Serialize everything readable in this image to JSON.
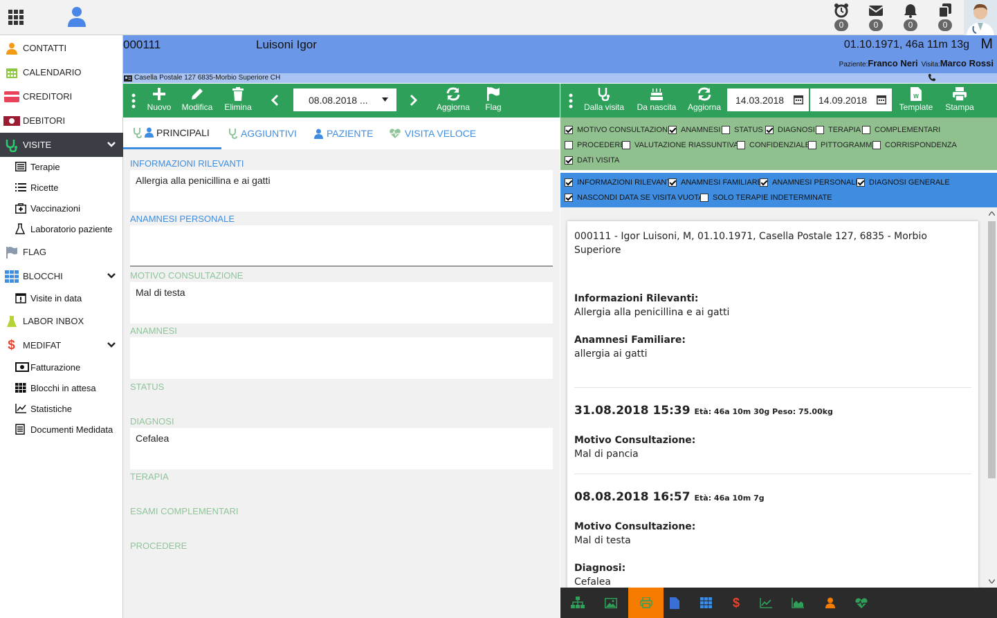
{
  "topbar": {
    "badges": [
      "0",
      "0",
      "0",
      "0"
    ],
    "icons": [
      "alarm-clock-icon",
      "envelope-icon",
      "bell-icon",
      "copy-icon"
    ]
  },
  "sidebar": {
    "contatti": "CONTATTI",
    "calendario": "CALENDARIO",
    "creditori": "CREDITORI",
    "debitori": "DEBITORI",
    "visite": "VISITE",
    "terapie": "Terapie",
    "ricette": "Ricette",
    "vaccinazioni": "Vaccinazioni",
    "laboratorio": "Laboratorio paziente",
    "flag": "FLAG",
    "blocchi": "BLOCCHI",
    "visite_in_data": "Visite in data",
    "labor_inbox": "LABOR INBOX",
    "medifat": "MEDIFAT",
    "fatturazione": "Fatturazione",
    "blocchi_attesa": "Blocchi in attesa",
    "statistiche": "Statistiche",
    "documenti": "Documenti Medidata"
  },
  "patient": {
    "id": "000111",
    "name": "Luisoni Igor",
    "dob_age": "01.10.1971, 46a 11m 13g",
    "sex": "M",
    "paziente_label": "Paziente:",
    "paziente": "Franco Neri",
    "visita_label": "Visita:",
    "visita": "Marco Rossi",
    "address": "Casella Postale 127 6835-Morbio Superiore CH"
  },
  "left_toolbar": {
    "nuovo": "Nuovo",
    "modifica": "Modifica",
    "elimina": "Elimina",
    "date": "08.08.2018 ...",
    "aggiorna": "Aggiorna",
    "flag": "Flag"
  },
  "right_toolbar": {
    "dalla_visita": "Dalla visita",
    "da_nascita": "Da nascita",
    "aggiorna": "Aggiorna",
    "date_from": "14.03.2018",
    "date_to": "14.09.2018",
    "template": "Template",
    "stampa": "Stampa"
  },
  "tabs": {
    "principali": "PRINCIPALI",
    "aggiuntivi": "AGGIUNTIVI",
    "paziente": "PAZIENTE",
    "visita_veloce": "VISITA VELOCE"
  },
  "fields": {
    "info_label": "INFORMAZIONI RILEVANTI",
    "info_value": "Allergia alla penicillina e ai gatti",
    "anamnesi_personale_label": "ANAMNESI PERSONALE",
    "anamnesi_personale_value": "",
    "motivo_label": "MOTIVO CONSULTAZIONE",
    "motivo_value": "Mal di testa",
    "anamnesi_label": "ANAMNESI",
    "anamnesi_value": "",
    "status_label": "STATUS",
    "diagnosi_label": "DIAGNOSI",
    "diagnosi_value": "Cefalea",
    "terapia_label": "TERAPIA",
    "esami_label": "ESAMI COMPLEMENTARI",
    "procedere_label": "PROCEDERE"
  },
  "filters_green": [
    {
      "label": "MOTIVO CONSULTAZIONE",
      "checked": true
    },
    {
      "label": "ANAMNESI",
      "checked": true
    },
    {
      "label": "STATUS",
      "checked": false
    },
    {
      "label": "DIAGNOSI",
      "checked": true
    },
    {
      "label": "TERAPIA",
      "checked": false
    },
    {
      "label": "COMPLEMENTARI",
      "checked": false
    },
    {
      "label": "PROCEDERE",
      "checked": false
    },
    {
      "label": "VALUTAZIONE RIASSUNTIVA",
      "checked": false
    },
    {
      "label": "CONFIDENZIALE",
      "checked": false
    },
    {
      "label": "PITTOGRAMMI",
      "checked": false
    },
    {
      "label": "CORRISPONDENZA",
      "checked": false
    },
    {
      "label": "DATI VISITA",
      "checked": true
    }
  ],
  "filters_blue": [
    {
      "label": "INFORMAZIONI RILEVANTI",
      "checked": true
    },
    {
      "label": "ANAMNESI FAMILIARE",
      "checked": true
    },
    {
      "label": "ANAMNESI PERSONALE",
      "checked": true
    },
    {
      "label": "DIAGNOSI GENERALE",
      "checked": true
    },
    {
      "label": "NASCONDI DATA SE VISITA VUOTA",
      "checked": true
    },
    {
      "label": "SOLO TERAPIE INDETERMINATE",
      "checked": false
    }
  ],
  "preview": {
    "header1": "000111 - Igor Luisoni, M, 01.10.1971, Casella Postale 127, 6835 - Morbio",
    "header2": "Superiore",
    "info_title": "Informazioni Rilevanti:",
    "info_value": "Allergia alla penicillina e ai gatti",
    "fam_title": "Anamnesi Familiare:",
    "fam_value": "allergia ai gatti",
    "v1_date": "31.08.2018 15:39",
    "v1_meta": "Età: 46a 10m 30g Peso: 75.00kg",
    "v1_motivo_title": "Motivo Consultazione:",
    "v1_motivo": "Mal di pancia",
    "v2_date": "08.08.2018 16:57",
    "v2_meta": "Età: 46a 10m 7g",
    "v2_motivo_title": "Motivo Consultazione:",
    "v2_motivo": "Mal di testa",
    "v2_diag_title": "Diagnosi:",
    "v2_diag": "Cefalea"
  },
  "colors": {
    "green": "#2ea05a",
    "blue": "#3f8de0",
    "header_blue": "#6b97e8",
    "dark": "#2b2b2b",
    "orange": "#f57c00"
  }
}
